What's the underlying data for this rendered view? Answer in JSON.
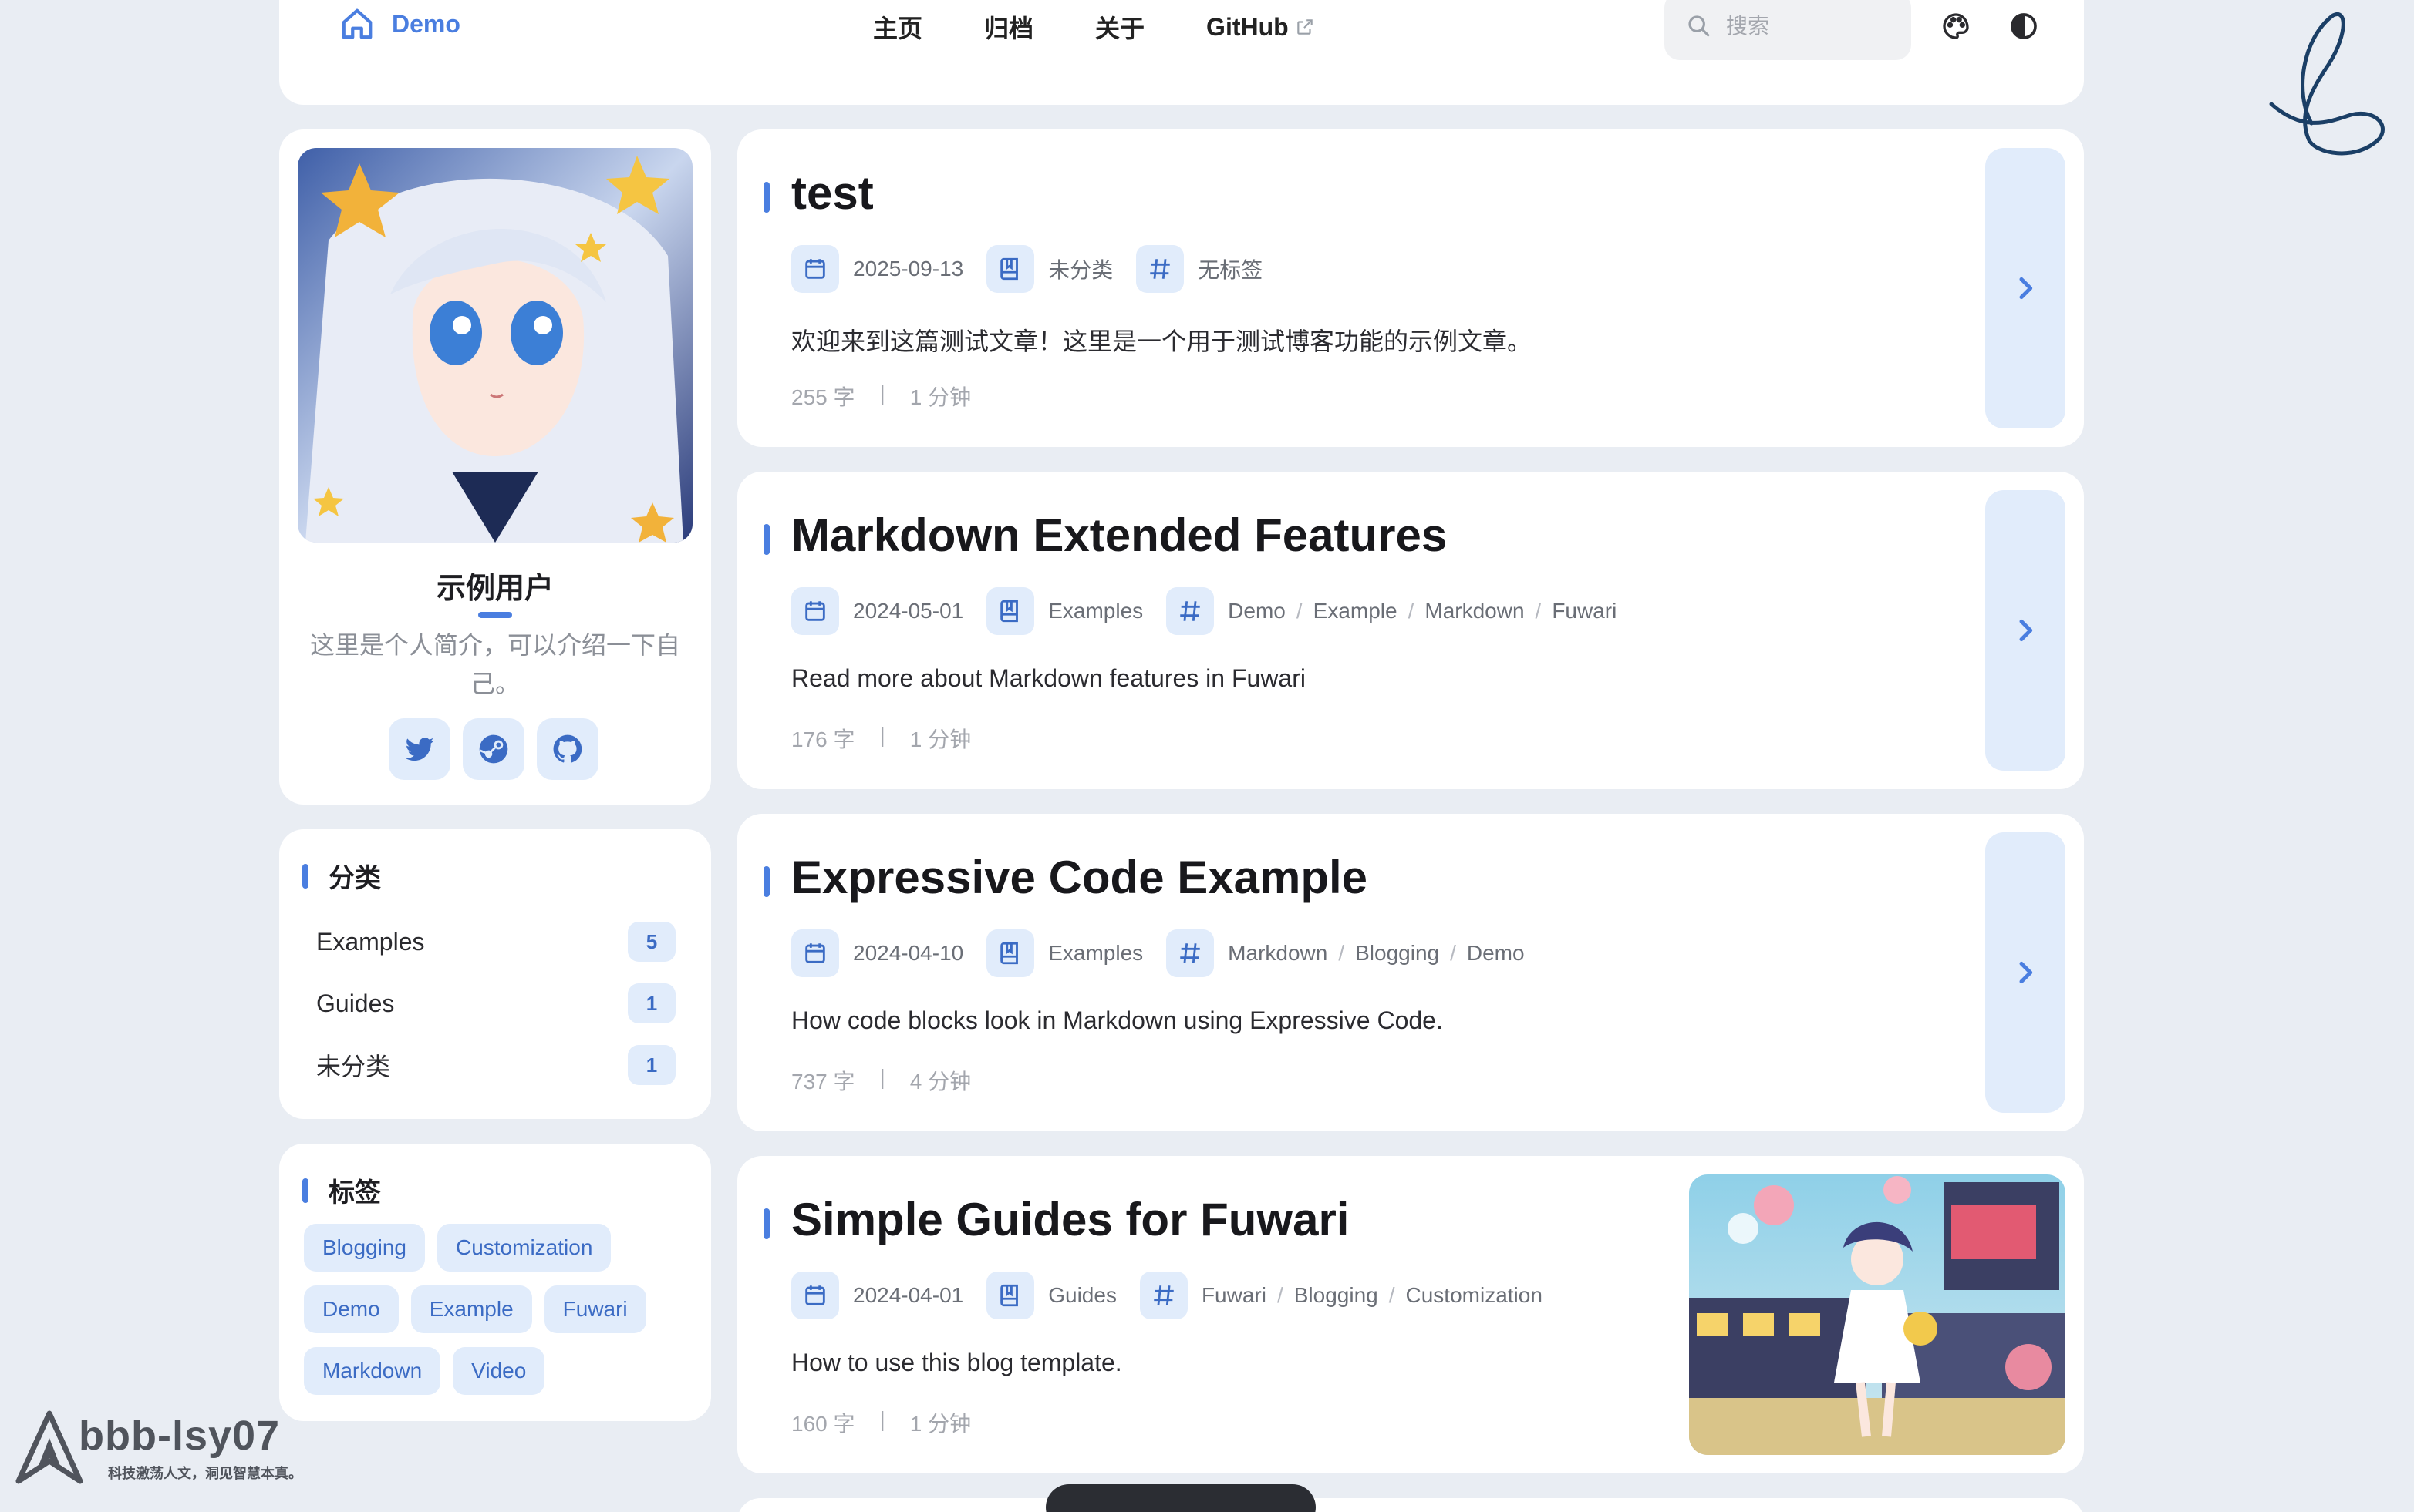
{
  "nav": {
    "brand": "Demo",
    "links": [
      "主页",
      "归档",
      "关于",
      "GitHub"
    ],
    "search_placeholder": "搜索"
  },
  "profile": {
    "name": "示例用户",
    "bio": "这里是个人简介，可以介绍一下自己。",
    "socials": [
      "twitter-icon",
      "steam-icon",
      "github-icon"
    ]
  },
  "categories": {
    "title": "分类",
    "items": [
      {
        "name": "Examples",
        "count": "5"
      },
      {
        "name": "Guides",
        "count": "1"
      },
      {
        "name": "未分类",
        "count": "1"
      }
    ]
  },
  "tags": {
    "title": "标签",
    "items": [
      "Blogging",
      "Customization",
      "Demo",
      "Example",
      "Fuwari",
      "Markdown",
      "Video"
    ]
  },
  "posts": [
    {
      "title": "test",
      "date": "2025-09-13",
      "category": "未分类",
      "tags": [
        "无标签"
      ],
      "description": "欢迎来到这篇测试文章！这里是一个用于测试博客功能的示例文章。",
      "words": "255 字",
      "read_time": "1 分钟",
      "has_cover": false
    },
    {
      "title": "Markdown Extended Features",
      "date": "2024-05-01",
      "category": "Examples",
      "tags": [
        "Demo",
        "Example",
        "Markdown",
        "Fuwari"
      ],
      "description": "Read more about Markdown features in Fuwari",
      "words": "176 字",
      "read_time": "1 分钟",
      "has_cover": false
    },
    {
      "title": "Expressive Code Example",
      "date": "2024-04-10",
      "category": "Examples",
      "tags": [
        "Markdown",
        "Blogging",
        "Demo"
      ],
      "description": "How code blocks look in Markdown using Expressive Code.",
      "words": "737 字",
      "read_time": "4 分钟",
      "has_cover": false
    },
    {
      "title": "Simple Guides for Fuwari",
      "date": "2024-04-01",
      "category": "Guides",
      "tags": [
        "Fuwari",
        "Blogging",
        "Customization"
      ],
      "description": "How to use this blog template.",
      "words": "160 字",
      "read_time": "1 分钟",
      "has_cover": true
    }
  ],
  "watermark": {
    "name": "bbb-lsy07",
    "slogan": "科技激荡人文，洞见智慧本真。"
  },
  "colors": {
    "accent": "#4a7ee0",
    "accent_soft": "#e1ecfb",
    "background": "#e9edf3"
  }
}
